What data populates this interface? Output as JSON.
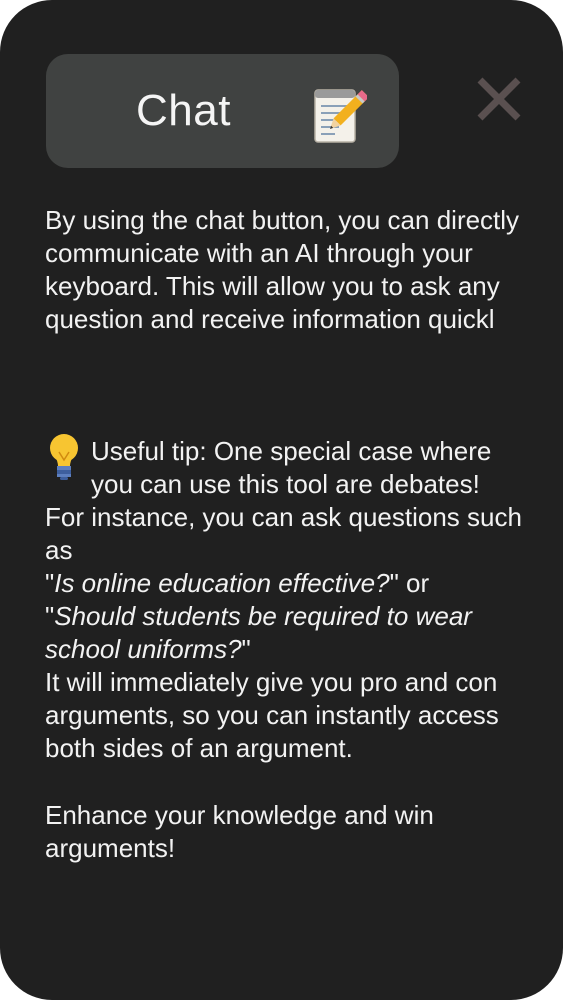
{
  "header": {
    "chat_label": "Chat",
    "chat_icon": "memo-icon",
    "close_icon": "close-icon"
  },
  "intro": {
    "text": "By using the chat button, you can directly communicate with an AI through your keyboard. This will allow you to ask any question and receive information quickl"
  },
  "tip": {
    "icon": "lightbulb-icon",
    "line1": "Useful tip: One special case where",
    "line2": "you can use this tool are debates!",
    "lead": "For instance, you can ask questions such as",
    "example1": "Is online education effective?",
    "connector": "or",
    "example2": "Should students be required to wear school uniforms?",
    "result": "It will immediately give you pro and con arguments, so you can instantly access both sides of an argument."
  },
  "outro": {
    "text": "Enhance your knowledge and win arguments!"
  },
  "colors": {
    "panel_background": "#202020",
    "button_background": "#404241",
    "text": "#f2f2f2",
    "close_icon": "#5a5050"
  }
}
